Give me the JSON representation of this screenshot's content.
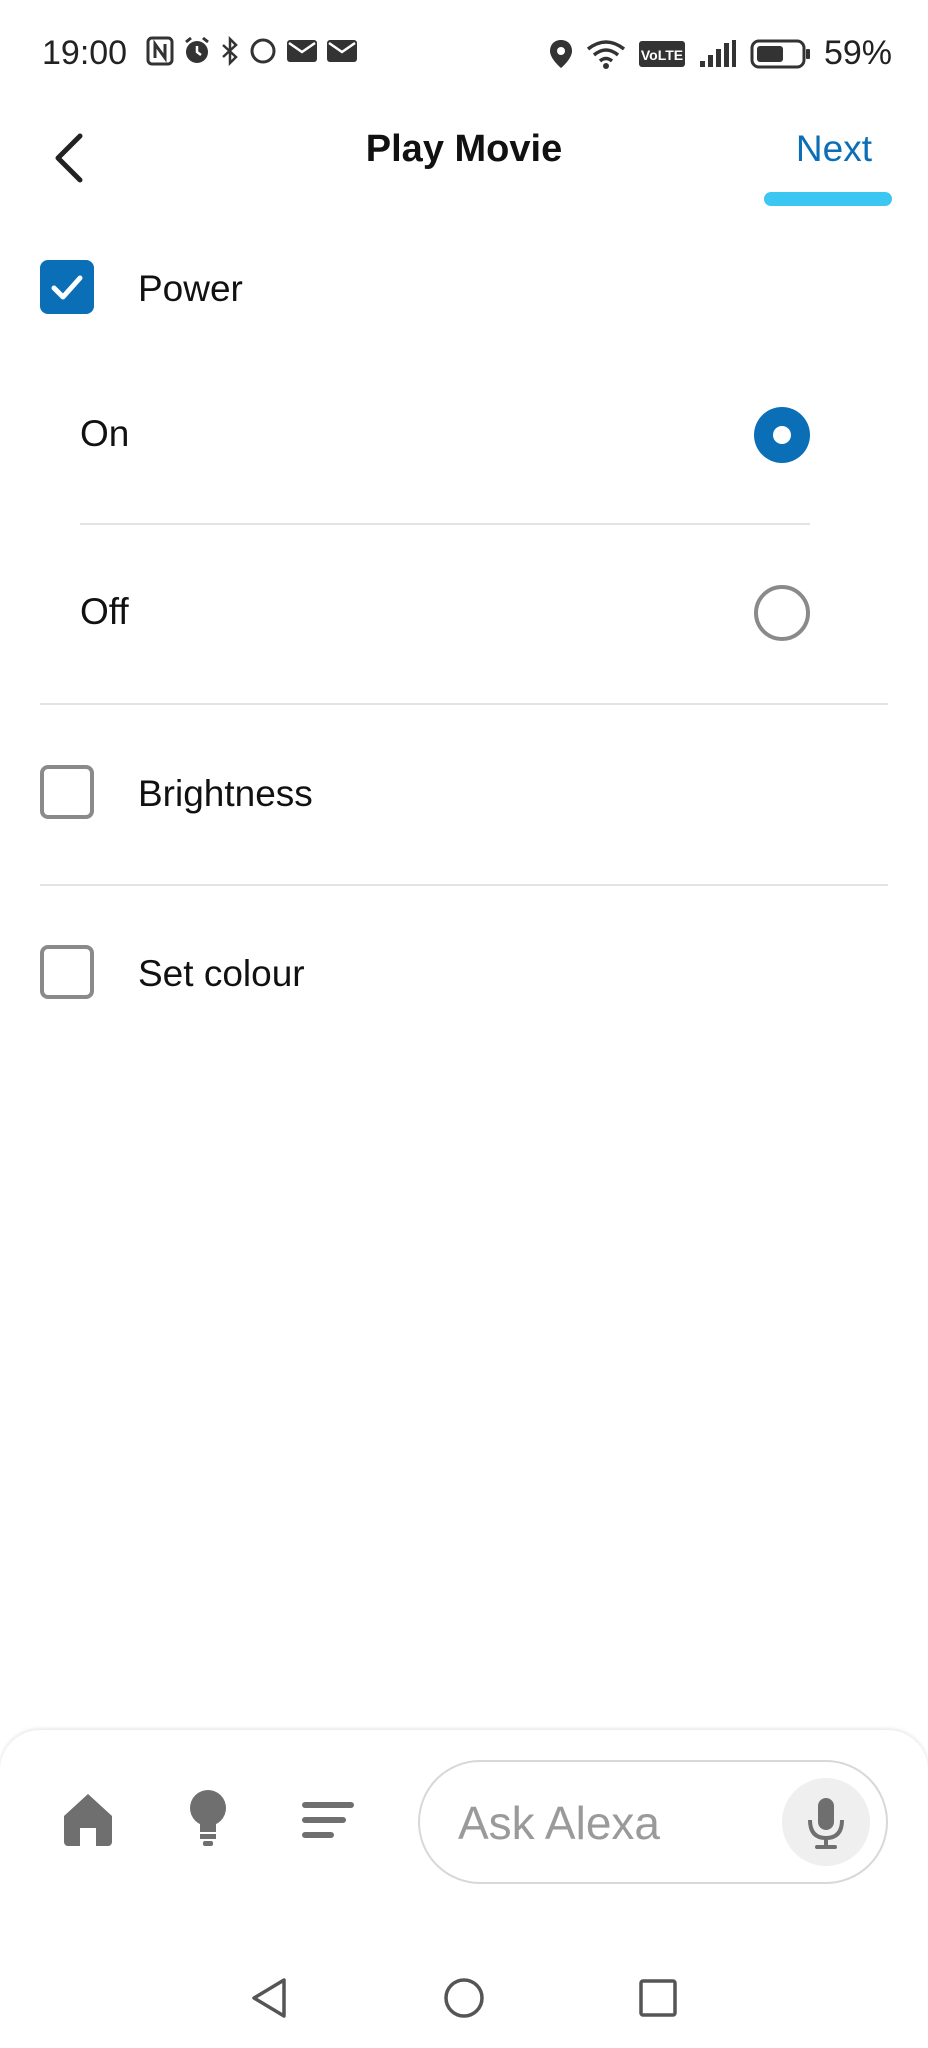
{
  "status_bar": {
    "time": "19:00",
    "battery_percent": "59%",
    "left_icons": [
      "nfc-icon",
      "alarm-icon",
      "bluetooth-icon",
      "circle-icon",
      "mail-icon",
      "mail-icon"
    ],
    "right_icons": [
      "location-icon",
      "wifi-icon",
      "volte-icon",
      "signal-icon",
      "battery-icon"
    ],
    "volte_label": "VoLTE"
  },
  "header": {
    "title": "Play Movie",
    "next_label": "Next"
  },
  "options": {
    "power": {
      "label": "Power",
      "checked": true
    },
    "power_on": {
      "label": "On",
      "selected": true
    },
    "power_off": {
      "label": "Off",
      "selected": false
    },
    "brightness": {
      "label": "Brightness",
      "checked": false
    },
    "set_colour": {
      "label": "Set colour",
      "checked": false
    }
  },
  "bottom_bar": {
    "nav_items": [
      "home-icon",
      "lightbulb-icon",
      "menu-icon"
    ],
    "ask_placeholder": "Ask Alexa"
  },
  "colors": {
    "accent": "#0b6fb8",
    "next_underline": "#3cc6f2"
  }
}
